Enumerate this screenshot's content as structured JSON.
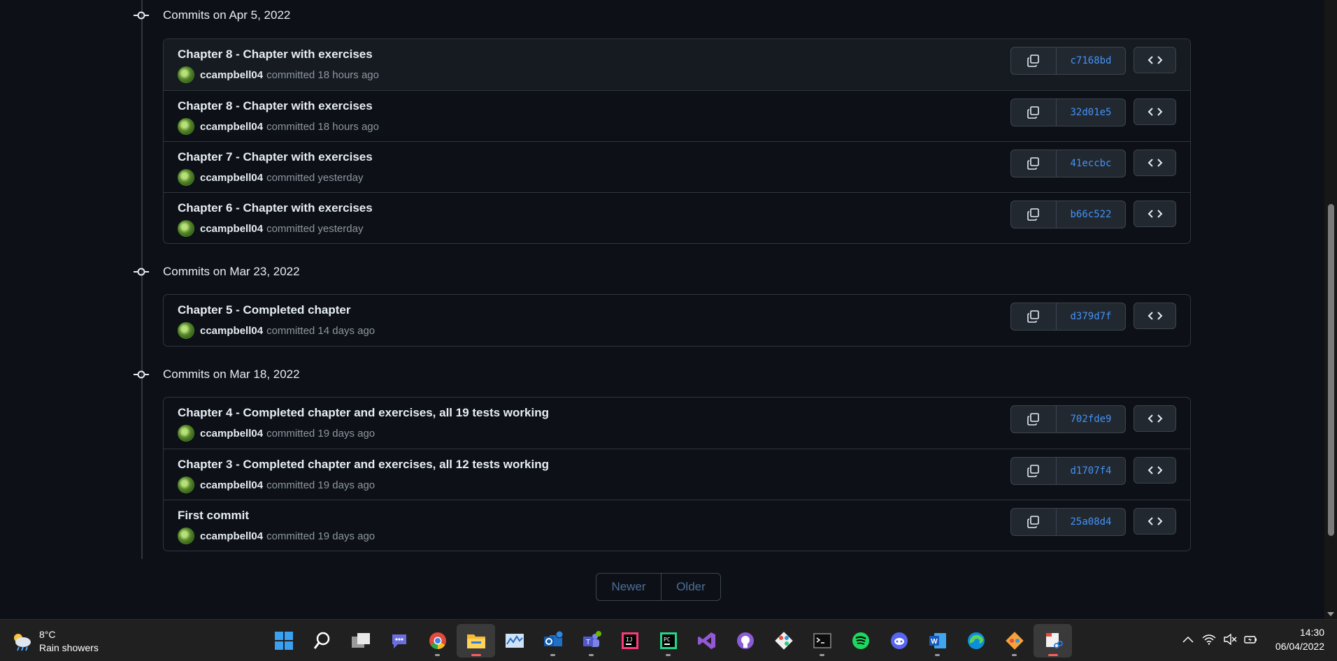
{
  "groups": [
    {
      "header": "Commits on Apr 5, 2022",
      "commits": [
        {
          "title": "Chapter 8 - Chapter with exercises",
          "author": "ccampbell04",
          "verb": "committed",
          "time": "18 hours ago",
          "sha": "c7168bd"
        },
        {
          "title": "Chapter 8 - Chapter with exercises",
          "author": "ccampbell04",
          "verb": "committed",
          "time": "18 hours ago",
          "sha": "32d01e5"
        },
        {
          "title": "Chapter 7 - Chapter with exercises",
          "author": "ccampbell04",
          "verb": "committed",
          "time": "yesterday",
          "sha": "41eccbc"
        },
        {
          "title": "Chapter 6 - Chapter with exercises",
          "author": "ccampbell04",
          "verb": "committed",
          "time": "yesterday",
          "sha": "b66c522"
        }
      ]
    },
    {
      "header": "Commits on Mar 23, 2022",
      "commits": [
        {
          "title": "Chapter 5 - Completed chapter",
          "author": "ccampbell04",
          "verb": "committed",
          "time": "14 days ago",
          "sha": "d379d7f"
        }
      ]
    },
    {
      "header": "Commits on Mar 18, 2022",
      "commits": [
        {
          "title": "Chapter 4 - Completed chapter and exercises, all 19 tests working",
          "author": "ccampbell04",
          "verb": "committed",
          "time": "19 days ago",
          "sha": "702fde9"
        },
        {
          "title": "Chapter 3 - Completed chapter and exercises, all 12 tests working",
          "author": "ccampbell04",
          "verb": "committed",
          "time": "19 days ago",
          "sha": "d1707f4"
        },
        {
          "title": "First commit",
          "author": "ccampbell04",
          "verb": "committed",
          "time": "19 days ago",
          "sha": "25a08d4"
        }
      ]
    }
  ],
  "pagination": {
    "newer": "Newer",
    "older": "Older"
  },
  "taskbar": {
    "weather_temp": "8°C",
    "weather_desc": "Rain showers",
    "apps": [
      "windows-start",
      "search",
      "task-view",
      "teams-chat",
      "chrome",
      "file-explorer",
      "resource-monitor",
      "outlook",
      "teams",
      "intellij",
      "pycharm",
      "visual-studio",
      "github-desktop",
      "git-extensions",
      "terminal",
      "spotify",
      "discord",
      "word",
      "edge",
      "gitkraken",
      "snipping-tool"
    ],
    "time": "14:30",
    "date": "06/04/2022"
  },
  "colors": {
    "background": "#0d1117",
    "border": "#30363d",
    "sha_link": "#4493f8",
    "muted": "#8d96a0"
  }
}
